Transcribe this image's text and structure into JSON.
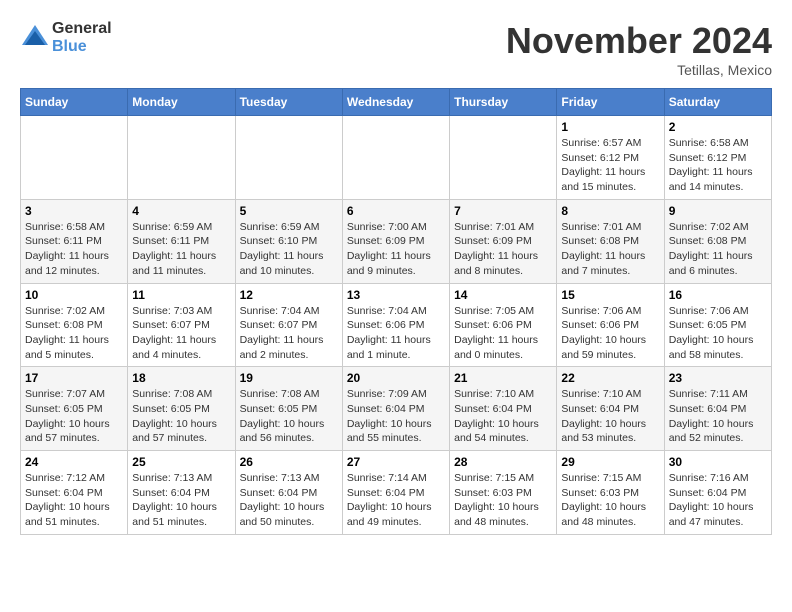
{
  "header": {
    "logo_line1": "General",
    "logo_line2": "Blue",
    "month": "November 2024",
    "location": "Tetillas, Mexico"
  },
  "columns": [
    "Sunday",
    "Monday",
    "Tuesday",
    "Wednesday",
    "Thursday",
    "Friday",
    "Saturday"
  ],
  "weeks": [
    [
      {
        "day": "",
        "info": ""
      },
      {
        "day": "",
        "info": ""
      },
      {
        "day": "",
        "info": ""
      },
      {
        "day": "",
        "info": ""
      },
      {
        "day": "",
        "info": ""
      },
      {
        "day": "1",
        "info": "Sunrise: 6:57 AM\nSunset: 6:12 PM\nDaylight: 11 hours and 15 minutes."
      },
      {
        "day": "2",
        "info": "Sunrise: 6:58 AM\nSunset: 6:12 PM\nDaylight: 11 hours and 14 minutes."
      }
    ],
    [
      {
        "day": "3",
        "info": "Sunrise: 6:58 AM\nSunset: 6:11 PM\nDaylight: 11 hours and 12 minutes."
      },
      {
        "day": "4",
        "info": "Sunrise: 6:59 AM\nSunset: 6:11 PM\nDaylight: 11 hours and 11 minutes."
      },
      {
        "day": "5",
        "info": "Sunrise: 6:59 AM\nSunset: 6:10 PM\nDaylight: 11 hours and 10 minutes."
      },
      {
        "day": "6",
        "info": "Sunrise: 7:00 AM\nSunset: 6:09 PM\nDaylight: 11 hours and 9 minutes."
      },
      {
        "day": "7",
        "info": "Sunrise: 7:01 AM\nSunset: 6:09 PM\nDaylight: 11 hours and 8 minutes."
      },
      {
        "day": "8",
        "info": "Sunrise: 7:01 AM\nSunset: 6:08 PM\nDaylight: 11 hours and 7 minutes."
      },
      {
        "day": "9",
        "info": "Sunrise: 7:02 AM\nSunset: 6:08 PM\nDaylight: 11 hours and 6 minutes."
      }
    ],
    [
      {
        "day": "10",
        "info": "Sunrise: 7:02 AM\nSunset: 6:08 PM\nDaylight: 11 hours and 5 minutes."
      },
      {
        "day": "11",
        "info": "Sunrise: 7:03 AM\nSunset: 6:07 PM\nDaylight: 11 hours and 4 minutes."
      },
      {
        "day": "12",
        "info": "Sunrise: 7:04 AM\nSunset: 6:07 PM\nDaylight: 11 hours and 2 minutes."
      },
      {
        "day": "13",
        "info": "Sunrise: 7:04 AM\nSunset: 6:06 PM\nDaylight: 11 hours and 1 minute."
      },
      {
        "day": "14",
        "info": "Sunrise: 7:05 AM\nSunset: 6:06 PM\nDaylight: 11 hours and 0 minutes."
      },
      {
        "day": "15",
        "info": "Sunrise: 7:06 AM\nSunset: 6:06 PM\nDaylight: 10 hours and 59 minutes."
      },
      {
        "day": "16",
        "info": "Sunrise: 7:06 AM\nSunset: 6:05 PM\nDaylight: 10 hours and 58 minutes."
      }
    ],
    [
      {
        "day": "17",
        "info": "Sunrise: 7:07 AM\nSunset: 6:05 PM\nDaylight: 10 hours and 57 minutes."
      },
      {
        "day": "18",
        "info": "Sunrise: 7:08 AM\nSunset: 6:05 PM\nDaylight: 10 hours and 57 minutes."
      },
      {
        "day": "19",
        "info": "Sunrise: 7:08 AM\nSunset: 6:05 PM\nDaylight: 10 hours and 56 minutes."
      },
      {
        "day": "20",
        "info": "Sunrise: 7:09 AM\nSunset: 6:04 PM\nDaylight: 10 hours and 55 minutes."
      },
      {
        "day": "21",
        "info": "Sunrise: 7:10 AM\nSunset: 6:04 PM\nDaylight: 10 hours and 54 minutes."
      },
      {
        "day": "22",
        "info": "Sunrise: 7:10 AM\nSunset: 6:04 PM\nDaylight: 10 hours and 53 minutes."
      },
      {
        "day": "23",
        "info": "Sunrise: 7:11 AM\nSunset: 6:04 PM\nDaylight: 10 hours and 52 minutes."
      }
    ],
    [
      {
        "day": "24",
        "info": "Sunrise: 7:12 AM\nSunset: 6:04 PM\nDaylight: 10 hours and 51 minutes."
      },
      {
        "day": "25",
        "info": "Sunrise: 7:13 AM\nSunset: 6:04 PM\nDaylight: 10 hours and 51 minutes."
      },
      {
        "day": "26",
        "info": "Sunrise: 7:13 AM\nSunset: 6:04 PM\nDaylight: 10 hours and 50 minutes."
      },
      {
        "day": "27",
        "info": "Sunrise: 7:14 AM\nSunset: 6:04 PM\nDaylight: 10 hours and 49 minutes."
      },
      {
        "day": "28",
        "info": "Sunrise: 7:15 AM\nSunset: 6:03 PM\nDaylight: 10 hours and 48 minutes."
      },
      {
        "day": "29",
        "info": "Sunrise: 7:15 AM\nSunset: 6:03 PM\nDaylight: 10 hours and 48 minutes."
      },
      {
        "day": "30",
        "info": "Sunrise: 7:16 AM\nSunset: 6:04 PM\nDaylight: 10 hours and 47 minutes."
      }
    ]
  ]
}
